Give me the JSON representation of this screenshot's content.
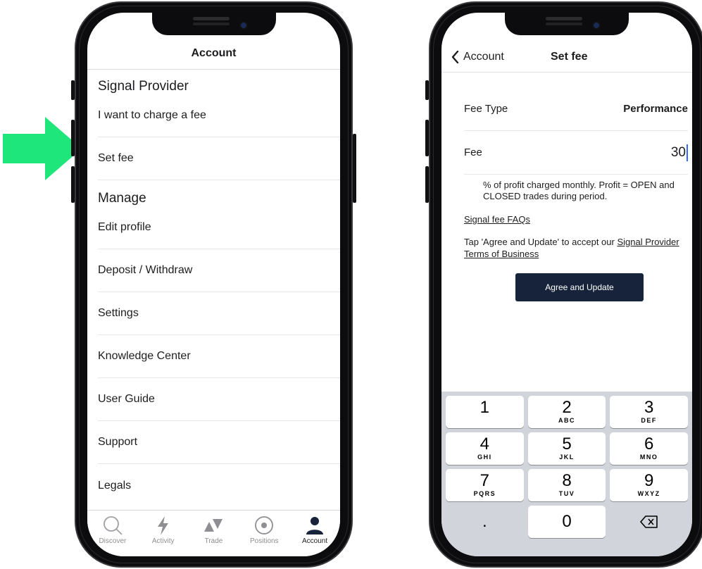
{
  "left": {
    "nav_title": "Account",
    "section_signal": "Signal Provider",
    "section_manage": "Manage",
    "signal_items": [
      "I want to charge a fee",
      "Set fee"
    ],
    "manage_items": [
      "Edit profile",
      "Deposit / Withdraw",
      "Settings",
      "Knowledge Center",
      "User Guide",
      "Support",
      "Legals"
    ],
    "tabs": [
      {
        "label": "Discover",
        "icon": "search-icon"
      },
      {
        "label": "Activity",
        "icon": "lightning-icon"
      },
      {
        "label": "Trade",
        "icon": "trade-icon"
      },
      {
        "label": "Positions",
        "icon": "positions-icon"
      },
      {
        "label": "Account",
        "icon": "person-icon"
      }
    ],
    "active_tab": "Account"
  },
  "right": {
    "back_label": "Account",
    "nav_title": "Set fee",
    "fee_type_label": "Fee Type",
    "fee_type_value": "Performance",
    "fee_label": "Fee",
    "fee_value": "30",
    "hint": "% of profit charged monthly. Profit = OPEN and CLOSED trades during period.",
    "faq_link": "Signal fee FAQs",
    "terms_prefix": "Tap 'Agree and Update' to accept our ",
    "terms_link": "Signal Provider Terms of Business",
    "agree_button": "Agree and Update",
    "keypad": {
      "k1": "1",
      "k1l": "",
      "k2": "2",
      "k2l": "ABC",
      "k3": "3",
      "k3l": "DEF",
      "k4": "4",
      "k4l": "GHI",
      "k5": "5",
      "k5l": "JKL",
      "k6": "6",
      "k6l": "MNO",
      "k7": "7",
      "k7l": "PQRS",
      "k8": "8",
      "k8l": "TUV",
      "k9": "9",
      "k9l": "WXYZ",
      "dot": ".",
      "k0": "0"
    }
  },
  "colors": {
    "arrow": "#1fe67a",
    "button_bg": "#17233a",
    "caret": "#2f6bff",
    "keypad_bg": "#d1d4da"
  }
}
